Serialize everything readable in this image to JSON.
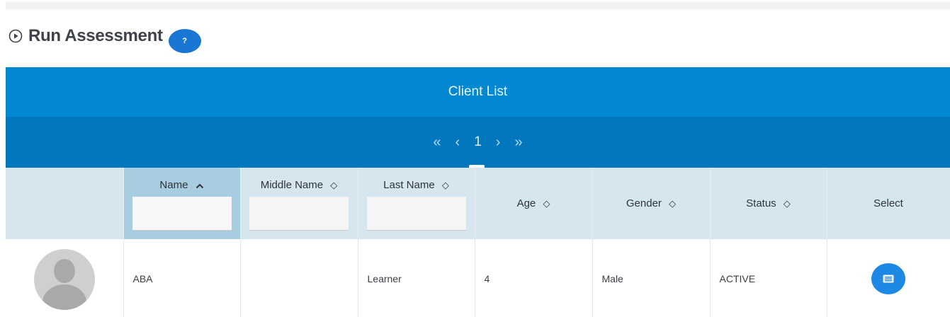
{
  "page": {
    "title": "Run Assessment",
    "help_label": "?"
  },
  "panel": {
    "title": "Client List"
  },
  "pager": {
    "first": "«",
    "prev": "‹",
    "current": "1",
    "next": "›",
    "last": "»"
  },
  "table": {
    "columns": [
      {
        "label": "",
        "sort": ""
      },
      {
        "label": "Name",
        "sort": "asc",
        "sort_glyph": "^"
      },
      {
        "label": "Middle Name",
        "sort": "none",
        "sort_glyph": "◇"
      },
      {
        "label": "Last Name",
        "sort": "none",
        "sort_glyph": "◇"
      },
      {
        "label": "Age",
        "sort": "none",
        "sort_glyph": "◇"
      },
      {
        "label": "Gender",
        "sort": "none",
        "sort_glyph": "◇"
      },
      {
        "label": "Status",
        "sort": "none",
        "sort_glyph": "◇"
      },
      {
        "label": "Select",
        "sort": ""
      }
    ],
    "filters": {
      "name": "",
      "middle_name": "",
      "last_name": ""
    },
    "rows": [
      {
        "avatar": "avatar-placeholder-icon",
        "name": "ABA",
        "middle_name": "",
        "last_name": "Learner",
        "age": "4",
        "gender": "Male",
        "status": "ACTIVE",
        "select_icon": "list-card-icon"
      }
    ]
  },
  "colors": {
    "header": "#0288d1",
    "pager": "#0277bd",
    "column_header": "#d6e6ef",
    "sorted_column": "#a8cde0",
    "accent": "#1e88e5"
  }
}
